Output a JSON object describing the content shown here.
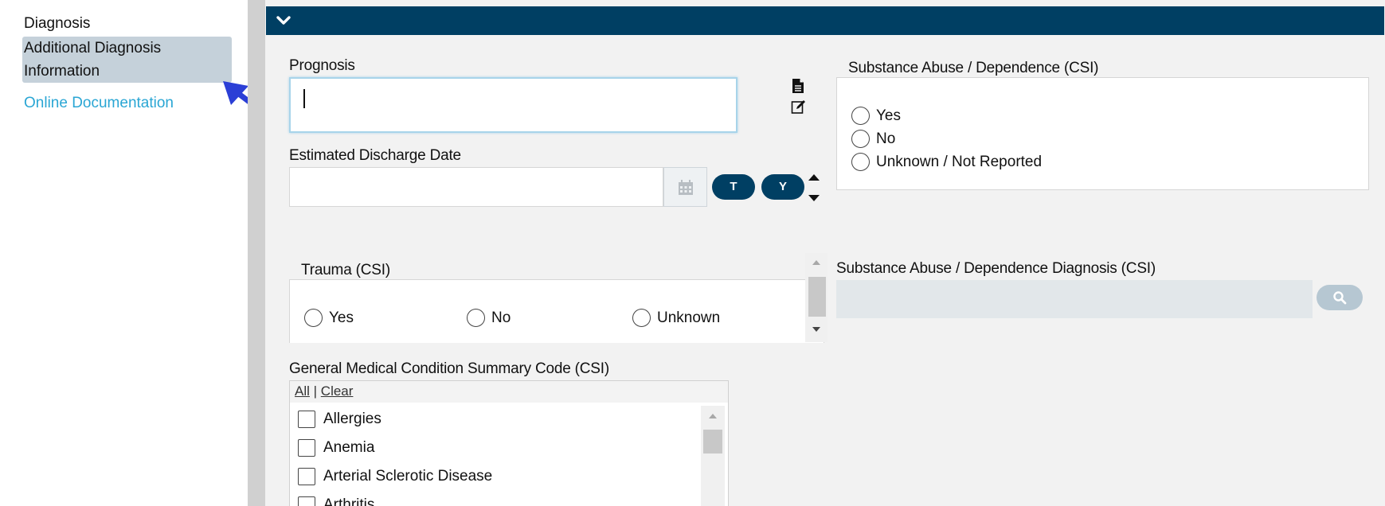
{
  "sidebar": {
    "items": [
      {
        "label": "Diagnosis"
      },
      {
        "label": "Additional Diagnosis Information",
        "line1": "Additional Diagnosis",
        "line2": "Information"
      },
      {
        "label": "Online Documentation"
      }
    ],
    "arrow_color": "#2b3fd6"
  },
  "header": {
    "color": "#003f63",
    "icon": "chevron-down-icon"
  },
  "prognosis": {
    "label": "Prognosis",
    "value": ""
  },
  "discharge": {
    "label": "Estimated Discharge Date",
    "value": "",
    "today_label": "T",
    "yesterday_label": "Y"
  },
  "substance_abuse": {
    "label": "Substance Abuse / Dependence (CSI)",
    "options": [
      "Yes",
      "No",
      "Unknown / Not Reported"
    ]
  },
  "trauma": {
    "label": "Trauma (CSI)",
    "options": [
      "Yes",
      "No",
      "Unknown"
    ]
  },
  "substance_diagnosis": {
    "label": "Substance Abuse / Dependence Diagnosis (CSI)",
    "value": ""
  },
  "general_medical": {
    "label": "General Medical Condition Summary Code (CSI)",
    "all_link": "All",
    "separator": "|",
    "clear_link": "Clear",
    "items": [
      "Allergies",
      "Anemia",
      "Arterial Sclerotic Disease",
      "Arthritis"
    ]
  }
}
